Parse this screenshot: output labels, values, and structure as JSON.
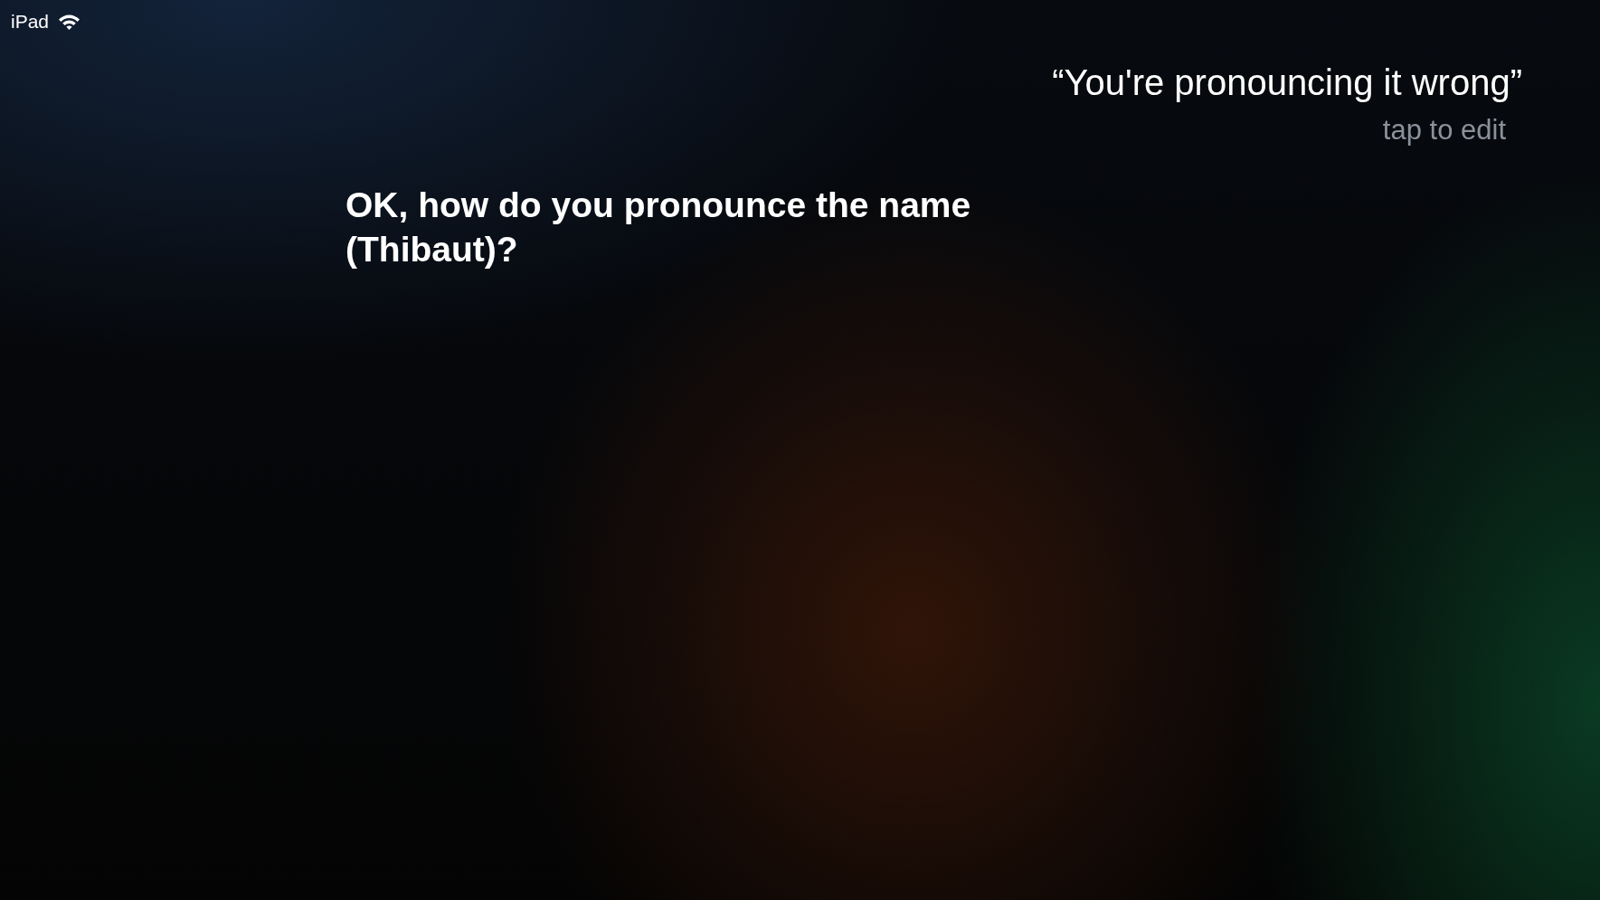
{
  "status_bar": {
    "device": "iPad"
  },
  "user_request": {
    "text": "“You're pronouncing it wrong”",
    "hint": "tap to edit"
  },
  "siri_response": {
    "text": "OK, how do you pronounce the name (Thibaut)?"
  }
}
